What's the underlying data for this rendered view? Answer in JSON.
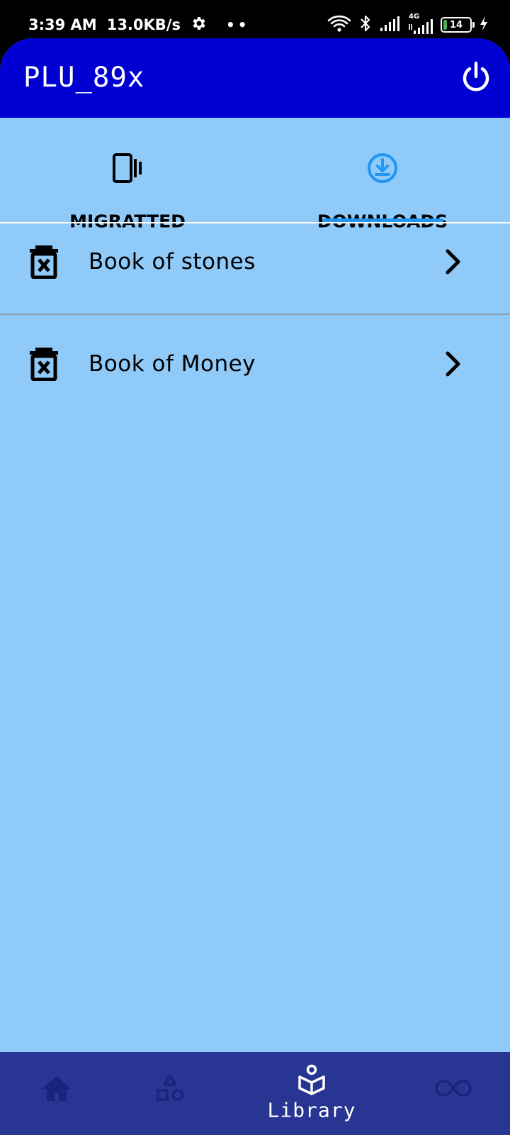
{
  "status_bar": {
    "time": "3:39 AM",
    "net_speed": "13.0KB/s",
    "dots": "••",
    "network_type": "4G",
    "battery_level": "14",
    "icons": [
      "settings-gear-icon",
      "wifi-icon",
      "bluetooth-icon",
      "signal-icon",
      "battery-icon",
      "charging-icon"
    ]
  },
  "app_bar": {
    "title": "PLU_89x",
    "power_icon": "power-icon"
  },
  "tabs": [
    {
      "label": "MIGRATTED",
      "icon": "phone-vibrate-icon",
      "selected": false
    },
    {
      "label": "DOWNLOADS",
      "icon": "download-circle-icon",
      "selected": true
    }
  ],
  "downloads": [
    {
      "title": "Book of stones",
      "icon": "delete-icon",
      "trailing_icon": "chevron-right-icon"
    },
    {
      "title": "Book of Money",
      "icon": "delete-icon",
      "trailing_icon": "chevron-right-icon"
    }
  ],
  "bottom_nav": {
    "items": [
      {
        "icon": "home-icon",
        "label": "",
        "selected": false
      },
      {
        "icon": "shapes-icon",
        "label": "",
        "selected": false
      },
      {
        "icon": "library-icon",
        "label": "Library",
        "selected": true
      },
      {
        "icon": "infinity-icon",
        "label": "",
        "selected": false
      }
    ]
  },
  "colors": {
    "app_bar": "#0000d2",
    "background": "#90caf9",
    "tab_indicator": "#2196f3",
    "bottom_nav": "#283593",
    "inactive_nav_icon": "#1a237e"
  }
}
